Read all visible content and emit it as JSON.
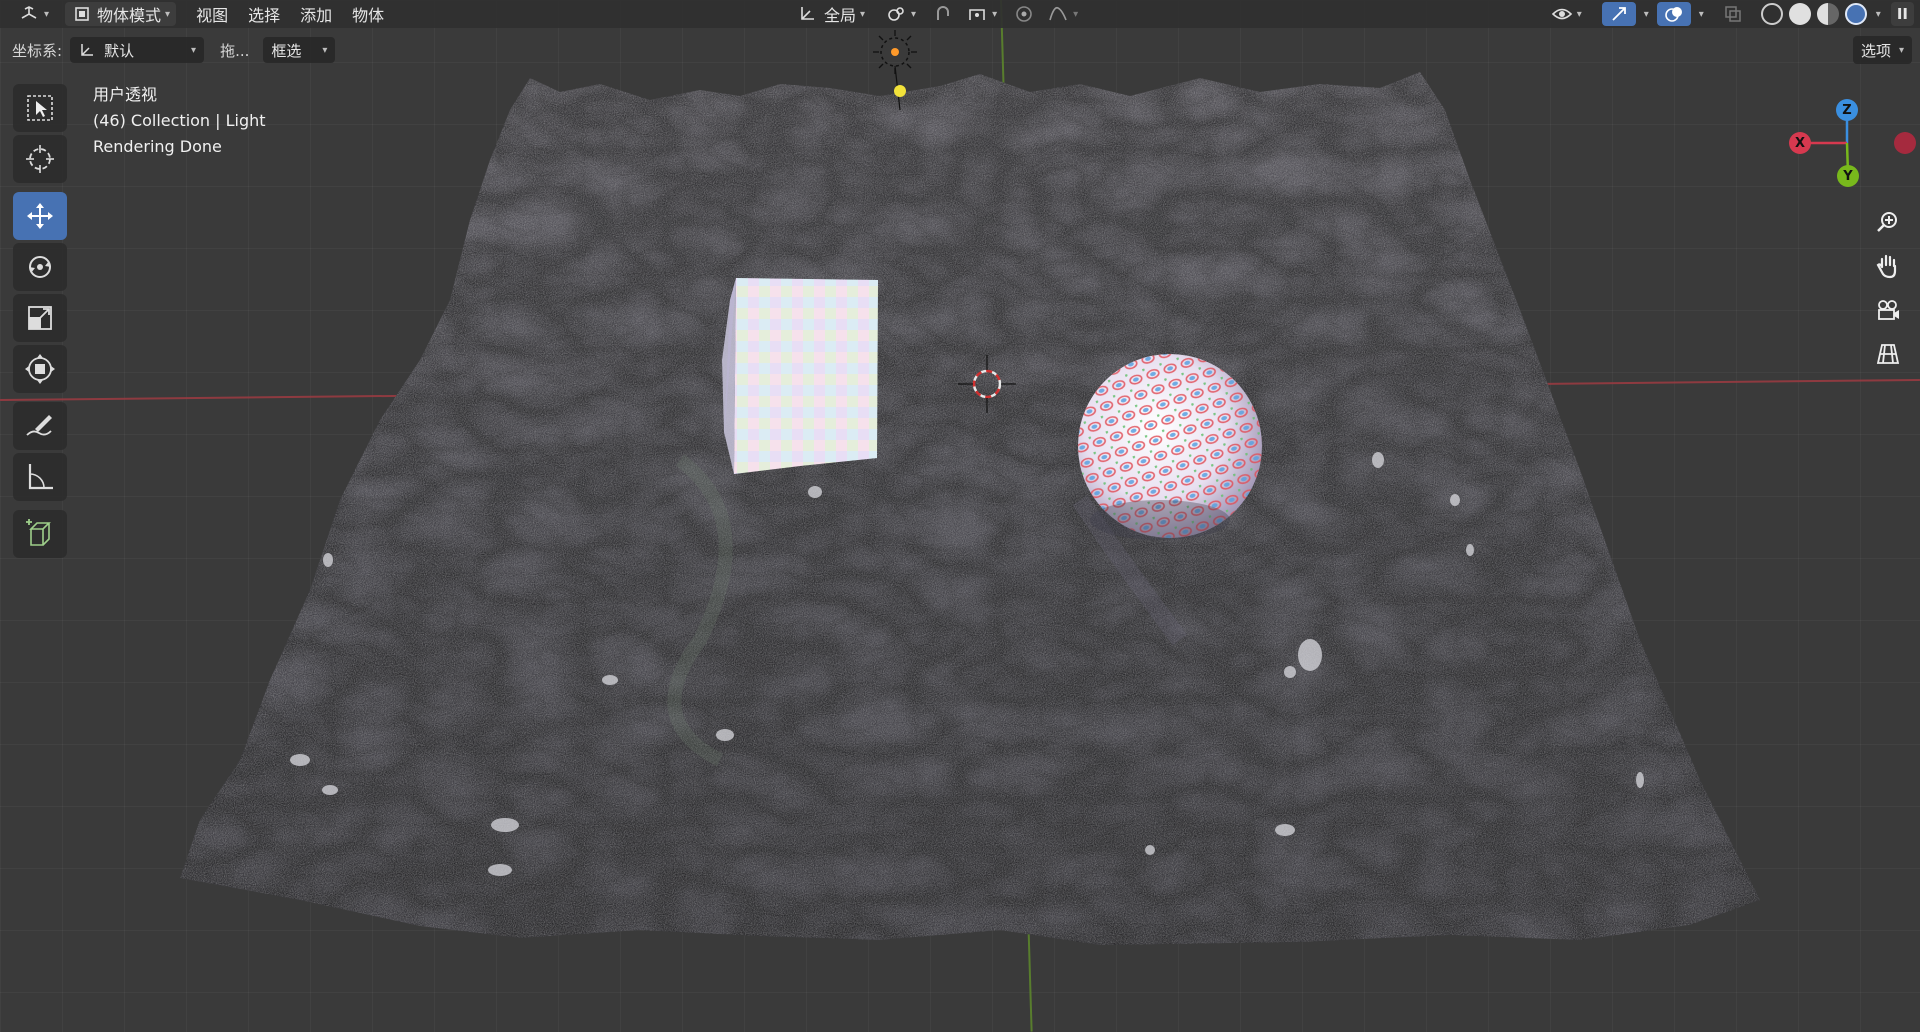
{
  "header": {
    "editor_type_icon": "3d-viewport-icon",
    "mode_label": "物体模式",
    "menus": [
      "视图",
      "选择",
      "添加",
      "物体"
    ],
    "transform_orientation": "全局",
    "icons": [
      "transform-pivot-icon",
      "snap-icon",
      "snap-target-icon",
      "proportional-editing-icon",
      "falloff-icon"
    ]
  },
  "header_right": {
    "icons": [
      "visibility-icon",
      "gizmo-icon",
      "overlay-icon",
      "xray-icon"
    ],
    "shading_modes": [
      "wireframe",
      "solid",
      "material-preview",
      "rendered"
    ],
    "active_shading": "rendered",
    "pause_label": "II"
  },
  "tool_settings": {
    "orientation_label": "坐标系:",
    "orientation_value": "默认",
    "drag_label": "拖...",
    "select_value": "框选",
    "options_label": "选项"
  },
  "toolbar": {
    "tools": [
      "select-box",
      "cursor",
      "move",
      "rotate",
      "scale",
      "transform",
      "annotate",
      "measure",
      "add-cube"
    ],
    "active": "move"
  },
  "viewport_info": {
    "view_name": "用户透视",
    "collection_line": "(46) Collection | Light",
    "status": "Rendering Done"
  },
  "gizmo": {
    "x_label": "X",
    "y_label": "Y",
    "z_label": "Z",
    "x_color": "#d6394f",
    "y_color": "#78b81c",
    "z_color": "#3a8fe0"
  },
  "nav_buttons": [
    "zoom-icon",
    "pan-hand-icon",
    "camera-view-icon",
    "ortho-grid-icon"
  ]
}
